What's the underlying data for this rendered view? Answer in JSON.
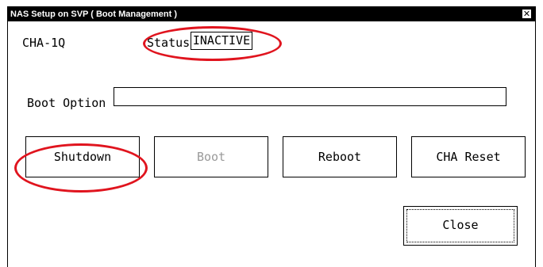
{
  "window": {
    "title": "NAS Setup on SVP ( Boot Management )",
    "close_glyph": "✕"
  },
  "device": {
    "name": "CHA-1Q",
    "status_label": "Status",
    "status_value": "INACTIVE"
  },
  "boot_option": {
    "label": "Boot Option",
    "value": ""
  },
  "buttons": {
    "shutdown": "Shutdown",
    "boot": "Boot",
    "reboot": "Reboot",
    "cha_reset": "CHA Reset",
    "close": "Close"
  },
  "annotation_color": "#e0141e"
}
